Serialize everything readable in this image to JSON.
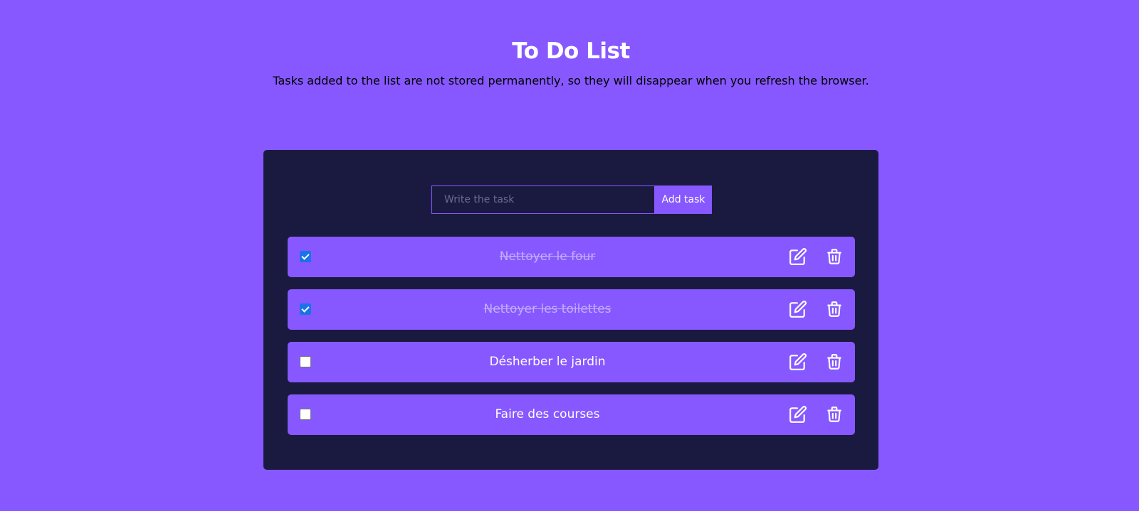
{
  "header": {
    "title": "To Do List",
    "subtitle": "Tasks added to the list are not stored permanently, so they will disappear when you refresh the browser."
  },
  "form": {
    "input_placeholder": "Write the task",
    "input_value": "",
    "add_label": "Add task"
  },
  "tasks": [
    {
      "text": "Nettoyer le four",
      "completed": true
    },
    {
      "text": "Nettoyer les toilettes",
      "completed": true
    },
    {
      "text": "Désherber le jardin",
      "completed": false
    },
    {
      "text": "Faire des courses",
      "completed": false
    }
  ],
  "icons": {
    "edit": "edit-icon",
    "delete": "trash-icon"
  },
  "colors": {
    "background": "#8758ff",
    "card": "#1a1a40",
    "accent": "#8758ff",
    "text": "#ffffff",
    "checkbox_checked": "#1a73e8"
  }
}
